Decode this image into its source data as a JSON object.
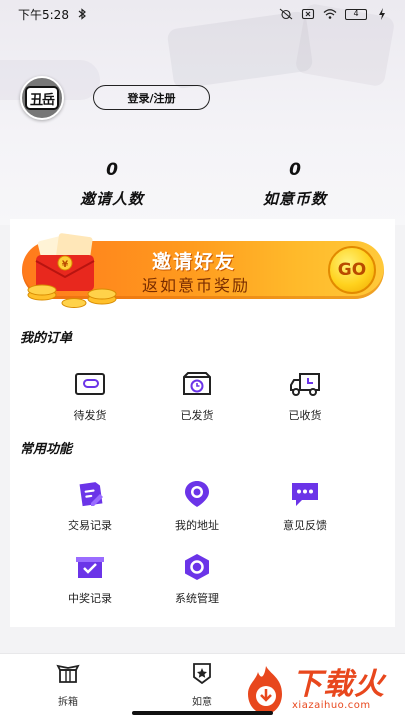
{
  "status_bar": {
    "time": "下午5:28",
    "battery": "4"
  },
  "profile": {
    "avatar_text": "丑岳",
    "login_button": "登录/注册"
  },
  "stats": [
    {
      "value": "0",
      "label": "邀请人数"
    },
    {
      "value": "0",
      "label": "如意币数"
    }
  ],
  "banner": {
    "title": "邀请好友",
    "subtitle": "返如意币奖励",
    "go_label": "GO"
  },
  "orders": {
    "title": "我的订单",
    "items": [
      {
        "label": "待发货",
        "icon": "wallet-card-icon"
      },
      {
        "label": "已发货",
        "icon": "shipped-box-icon"
      },
      {
        "label": "已收货",
        "icon": "delivery-truck-icon"
      }
    ]
  },
  "functions": {
    "title": "常用功能",
    "items": [
      {
        "label": "交易记录",
        "icon": "transaction-record-icon"
      },
      {
        "label": "我的地址",
        "icon": "location-icon"
      },
      {
        "label": "意见反馈",
        "icon": "feedback-chat-icon"
      },
      {
        "label": "中奖记录",
        "icon": "prize-record-icon"
      },
      {
        "label": "系统管理",
        "icon": "settings-hexagon-icon"
      }
    ]
  },
  "tabbar": {
    "items": [
      {
        "label": "拆箱",
        "icon": "box-open-icon"
      },
      {
        "label": "如意",
        "icon": "star-badge-icon"
      }
    ]
  },
  "watermark": {
    "cn": "下载火",
    "en": "xiazaihuo.com"
  },
  "colors": {
    "accent_purple": "#6b34e8",
    "banner_orange": "#ff8a1e",
    "watermark_red": "#e8471d"
  }
}
